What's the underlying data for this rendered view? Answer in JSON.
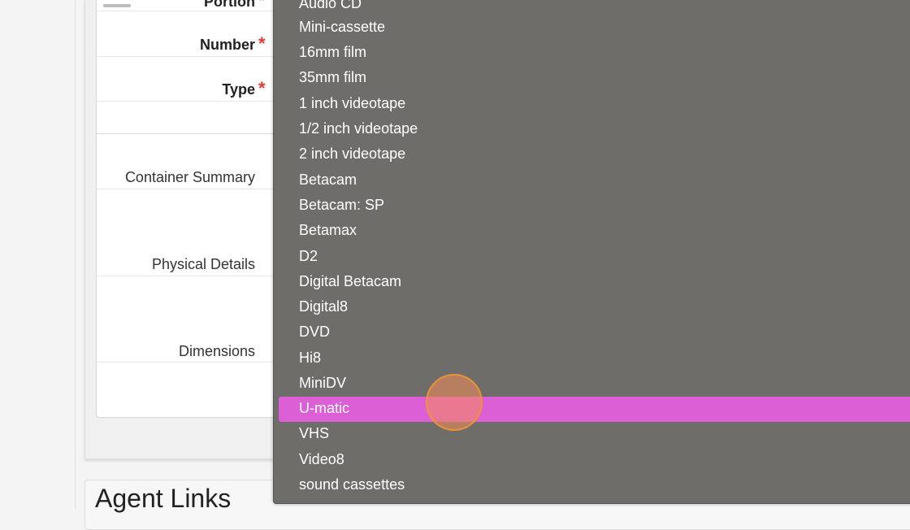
{
  "form": {
    "labels": {
      "portion": "Portion",
      "number": "Number",
      "type": "Type",
      "container_summary": "Container Summary",
      "physical_details": "Physical Details",
      "dimensions": "Dimensions"
    },
    "required_mark": "*"
  },
  "section": {
    "agent_links_title": "Agent Links"
  },
  "dropdown": {
    "options": [
      "Audio CD",
      "Mini-cassette",
      "16mm film",
      "35mm film",
      "1 inch videotape",
      "1/2 inch videotape",
      "2 inch videotape",
      "Betacam",
      "Betacam: SP",
      "Betamax",
      "D2",
      "Digital Betacam",
      "Digital8",
      "DVD",
      "Hi8",
      "MiniDV",
      "U-matic",
      "VHS",
      "Video8",
      "sound cassettes"
    ],
    "selected": "U-matic"
  },
  "colors": {
    "dropdown_bg": "#6e6d69",
    "highlight": "#dc5fd6",
    "required": "#e53935",
    "cursor": "#f5a05a"
  }
}
